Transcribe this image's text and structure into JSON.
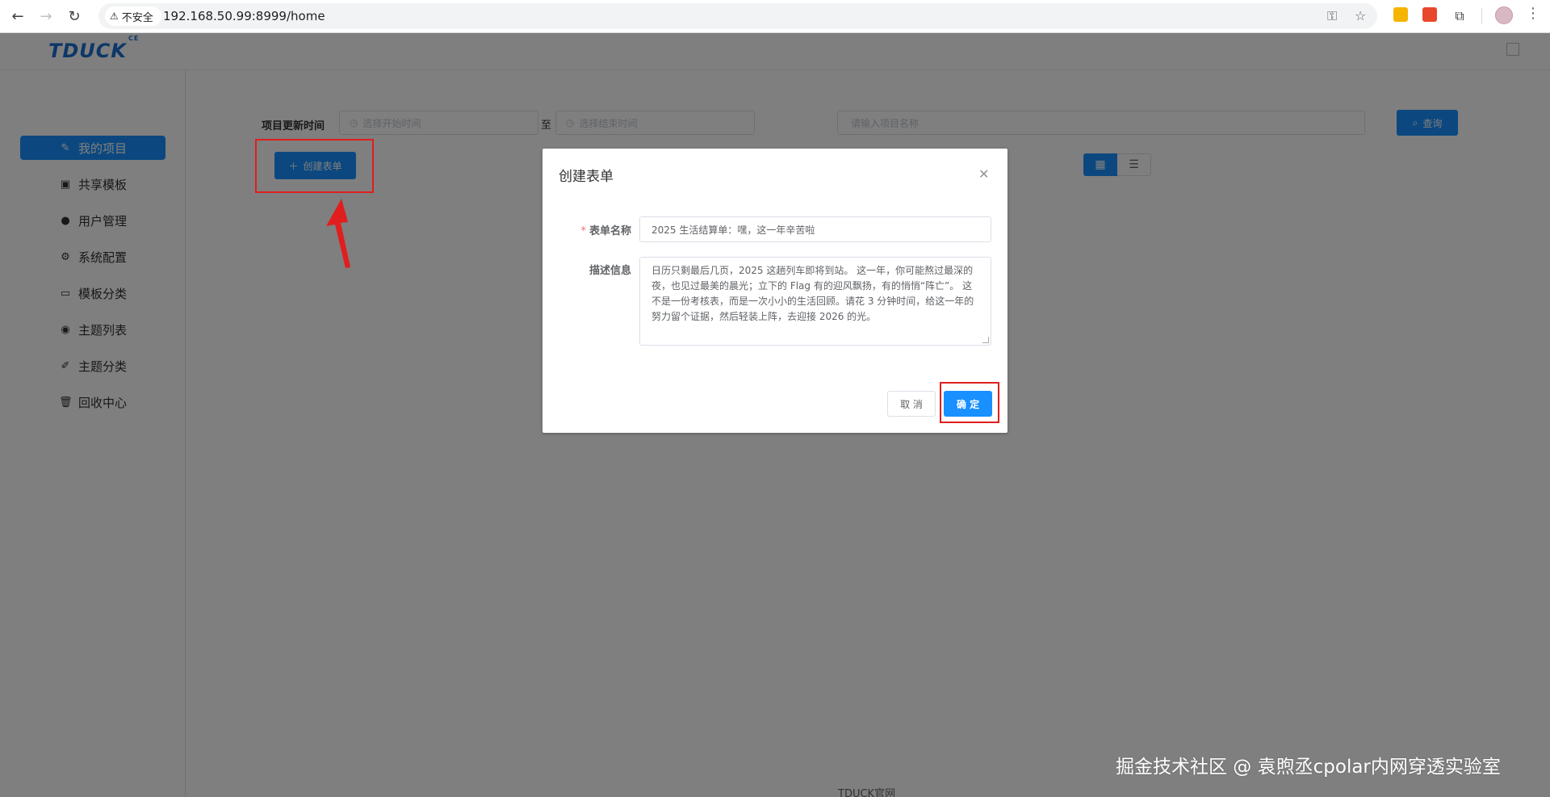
{
  "browser": {
    "security_label": "不安全",
    "url": "192.168.50.99:8999/home"
  },
  "app": {
    "logo_text": "TDUCK",
    "logo_badge": "CE"
  },
  "sidebar": {
    "items": [
      {
        "label": "我的项目",
        "icon": "edit-icon",
        "active": true
      },
      {
        "label": "共享模板",
        "icon": "template-icon",
        "active": false
      },
      {
        "label": "用户管理",
        "icon": "user-icon",
        "active": false
      },
      {
        "label": "系统配置",
        "icon": "gear-icon",
        "active": false
      },
      {
        "label": "模板分类",
        "icon": "card-icon",
        "active": false
      },
      {
        "label": "主题列表",
        "icon": "eye-icon",
        "active": false
      },
      {
        "label": "主题分类",
        "icon": "pen-icon",
        "active": false
      },
      {
        "label": "回收中心",
        "icon": "trash-icon",
        "active": false
      }
    ]
  },
  "filter": {
    "label": "项目更新时间",
    "start_placeholder": "选择开始时间",
    "to_label": "至",
    "end_placeholder": "选择结束时间",
    "name_placeholder": "请输入项目名称",
    "query_label": "查询"
  },
  "toolbar": {
    "create_label": "创建表单"
  },
  "footer": {
    "link_text": "TDUCK官网"
  },
  "dialog": {
    "title": "创建表单",
    "name_label": "表单名称",
    "name_value": "2025 生活结算单：嘿，这一年辛苦啦",
    "desc_label": "描述信息",
    "desc_value": "日历只剩最后几页，2025 这趟列车即将到站。 这一年，你可能熬过最深的夜，也见过最美的晨光；立下的 Flag 有的迎风飘扬，有的悄悄“阵亡”。 这不是一份考核表，而是一次小小的生活回顾。请花 3 分钟时间，给这一年的努力留个证据，然后轻装上阵，去迎接 2026 的光。",
    "cancel_label": "取 消",
    "ok_label": "确 定"
  },
  "watermark": "掘金技术社区 @ 袁煦丞cpolar内网穿透实验室",
  "colors": {
    "primary": "#1890ff",
    "annotation": "#e01e1e",
    "logo": "#1b6fd1"
  }
}
